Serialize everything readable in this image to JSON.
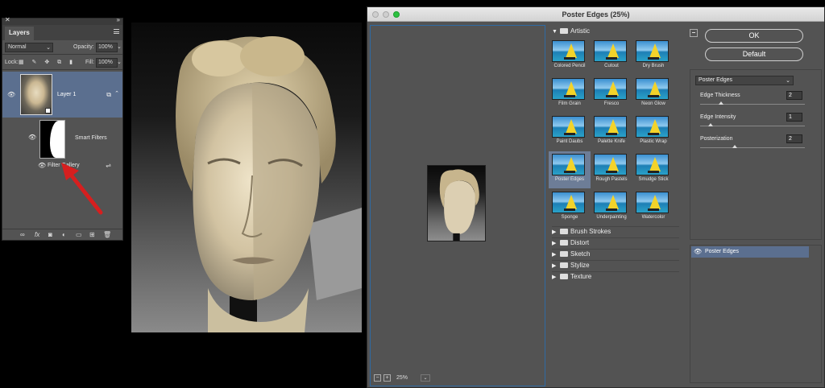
{
  "layers_panel": {
    "tab": "Layers",
    "blend_mode": "Normal",
    "opacity_label": "Opacity:",
    "opacity_value": "100%",
    "lock_label": "Lock:",
    "fill_label": "Fill:",
    "fill_value": "100%",
    "layer_name": "Layer 1",
    "smart_filters_label": "Smart Filters",
    "filter_name": "Filter Gallery"
  },
  "dialog": {
    "title": "Poster Edges (25%)",
    "zoom_value": "25%",
    "ok_label": "OK",
    "default_label": "Default",
    "filter_select": "Poster Edges",
    "params": [
      {
        "label": "Edge Thickness",
        "value": "2",
        "fraction": 0.2
      },
      {
        "label": "Edge Intensity",
        "value": "1",
        "fraction": 0.1
      },
      {
        "label": "Posterization",
        "value": "2",
        "fraction": 0.33
      }
    ],
    "applied_effect": "Poster Edges",
    "categories_open": "Artistic",
    "filters": [
      "Colored Pencil",
      "Cutout",
      "Dry Brush",
      "Film Grain",
      "Fresco",
      "Neon Glow",
      "Paint Daubs",
      "Palette Knife",
      "Plastic Wrap",
      "Poster Edges",
      "Rough Pastels",
      "Smudge Stick",
      "Sponge",
      "Underpainting",
      "Watercolor"
    ],
    "selected_filter": "Poster Edges",
    "categories_closed": [
      "Brush Strokes",
      "Distort",
      "Sketch",
      "Stylize",
      "Texture"
    ]
  }
}
